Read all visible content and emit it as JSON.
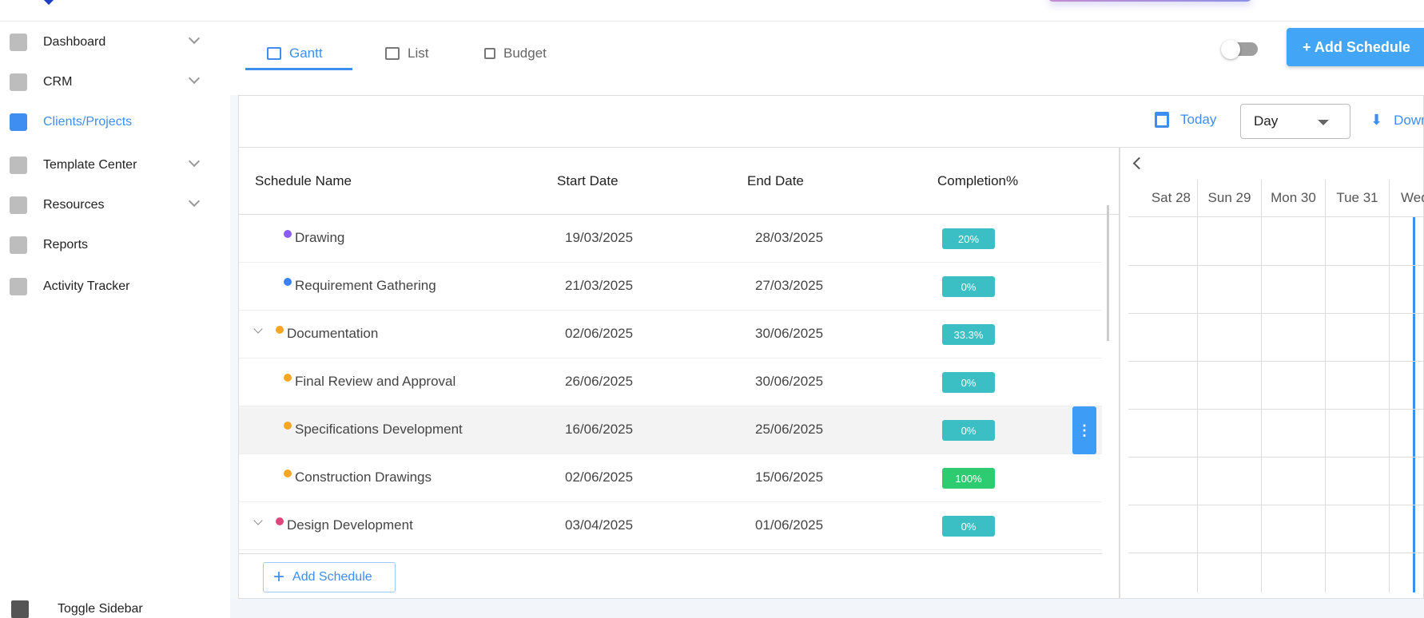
{
  "sidebar": {
    "items": [
      {
        "label": "Dashboard",
        "icon": "dashboard-icon",
        "expandable": true
      },
      {
        "label": "CRM",
        "icon": "crm-icon",
        "expandable": true
      },
      {
        "label": "Clients/Projects",
        "icon": "clients-icon",
        "expandable": false,
        "active": true
      },
      {
        "label": "Template Center",
        "icon": "template-icon",
        "expandable": true
      },
      {
        "label": "Resources",
        "icon": "resources-icon",
        "expandable": true
      },
      {
        "label": "Reports",
        "icon": "reports-icon",
        "expandable": false
      },
      {
        "label": "Activity Tracker",
        "icon": "activity-icon",
        "expandable": false
      }
    ],
    "toggle_label": "Toggle Sidebar"
  },
  "tabs": [
    {
      "label": "Gantt",
      "active": true
    },
    {
      "label": "List"
    },
    {
      "label": "Budget"
    }
  ],
  "add_schedule_label": "+ Add Schedule",
  "toolbar": {
    "today": "Today",
    "view": "Day",
    "download": "Down"
  },
  "columns": {
    "name": "Schedule Name",
    "start": "Start Date",
    "end": "End Date",
    "completion": "Completion%"
  },
  "rows": [
    {
      "name": "Drawing",
      "start": "19/03/2025",
      "end": "28/03/2025",
      "completion": "20%",
      "dot": "#8b5cf6",
      "parent": false,
      "badge": "#3bbfc4"
    },
    {
      "name": "Requirement Gathering",
      "start": "21/03/2025",
      "end": "27/03/2025",
      "completion": "0%",
      "dot": "#3b82f6",
      "parent": false,
      "badge": "#3bbfc4"
    },
    {
      "name": "Documentation",
      "start": "02/06/2025",
      "end": "30/06/2025",
      "completion": "33.3%",
      "dot": "#f5a623",
      "parent": true,
      "badge": "#3bbfc4"
    },
    {
      "name": "Final Review and Approval",
      "start": "26/06/2025",
      "end": "30/06/2025",
      "completion": "0%",
      "dot": "#f5a623",
      "parent": false,
      "badge": "#3bbfc4"
    },
    {
      "name": "Specifications Development",
      "start": "16/06/2025",
      "end": "25/06/2025",
      "completion": "0%",
      "dot": "#f5a623",
      "parent": false,
      "badge": "#3bbfc4",
      "selected": true
    },
    {
      "name": "Construction Drawings",
      "start": "02/06/2025",
      "end": "15/06/2025",
      "completion": "100%",
      "dot": "#f5a623",
      "parent": false,
      "badge": "#2ecc71"
    },
    {
      "name": "Design Development",
      "start": "03/04/2025",
      "end": "01/06/2025",
      "completion": "0%",
      "dot": "#e0457b",
      "parent": true,
      "badge": "#3bbfc4"
    }
  ],
  "add_schedule_row": "Add Schedule",
  "gantt": {
    "days": [
      "Sat 28",
      "Sun 29",
      "Mon 30",
      "Tue 31",
      "Wed"
    ]
  },
  "kebab": "⋮"
}
